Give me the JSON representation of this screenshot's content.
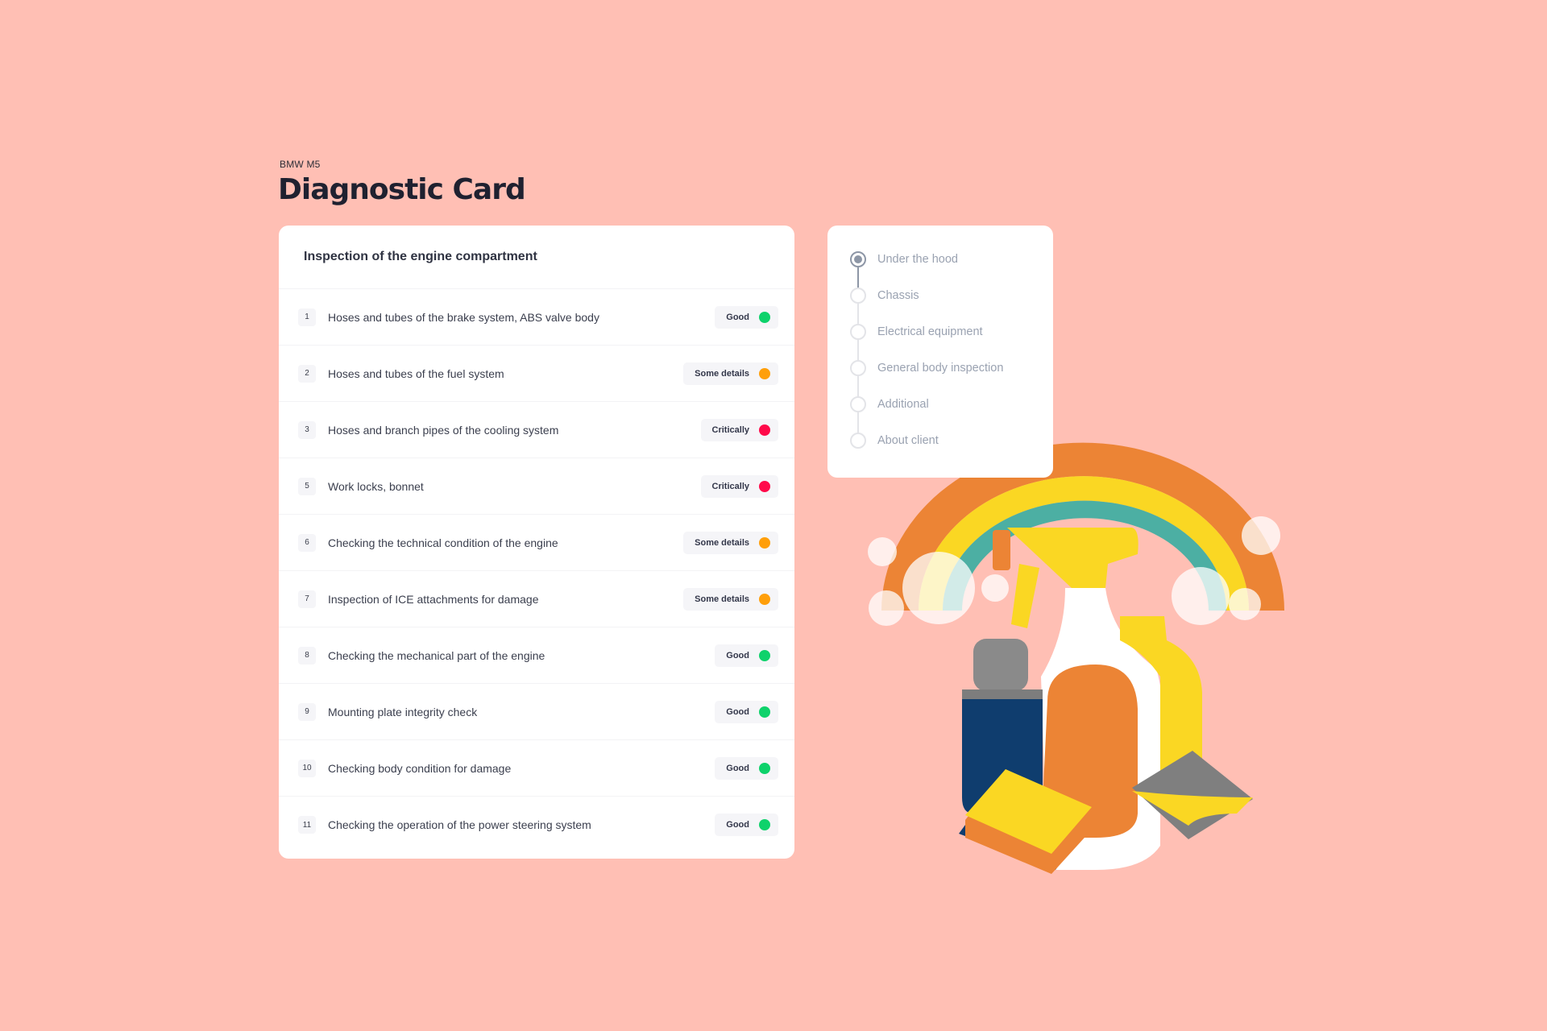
{
  "header": {
    "subtitle": "BMW M5",
    "title": "Diagnostic Card"
  },
  "inspection": {
    "title": "Inspection of the engine compartment",
    "items": [
      {
        "num": "1",
        "label": "Hoses and tubes of the brake system, ABS valve body",
        "status": "Good",
        "color": "#0ED26B"
      },
      {
        "num": "2",
        "label": "Hoses and tubes of the fuel system",
        "status": "Some details",
        "color": "#FF9F0A"
      },
      {
        "num": "3",
        "label": "Hoses and branch pipes of the cooling system",
        "status": "Critically",
        "color": "#FF0A4A"
      },
      {
        "num": "5",
        "label": "Work locks, bonnet",
        "status": "Critically",
        "color": "#FF0A4A"
      },
      {
        "num": "6",
        "label": "Checking the technical condition of the engine",
        "status": "Some details",
        "color": "#FF9F0A"
      },
      {
        "num": "7",
        "label": "Inspection of ICE attachments for damage",
        "status": "Some details",
        "color": "#FF9F0A"
      },
      {
        "num": "8",
        "label": "Checking the mechanical part of the engine",
        "status": "Good",
        "color": "#0ED26B"
      },
      {
        "num": "9",
        "label": "Mounting plate integrity check",
        "status": "Good",
        "color": "#0ED26B"
      },
      {
        "num": "10",
        "label": "Checking body condition for damage",
        "status": "Good",
        "color": "#0ED26B"
      },
      {
        "num": "11",
        "label": "Checking the operation of the power steering system",
        "status": "Good",
        "color": "#0ED26B"
      }
    ]
  },
  "steps": {
    "active_index": 0,
    "items": [
      "Under the hood",
      "Chassis",
      "Electrical equipment",
      "General body inspection",
      "Additional",
      "About client"
    ]
  },
  "illustration": {
    "subject": "cleaning-supplies-rainbow"
  }
}
